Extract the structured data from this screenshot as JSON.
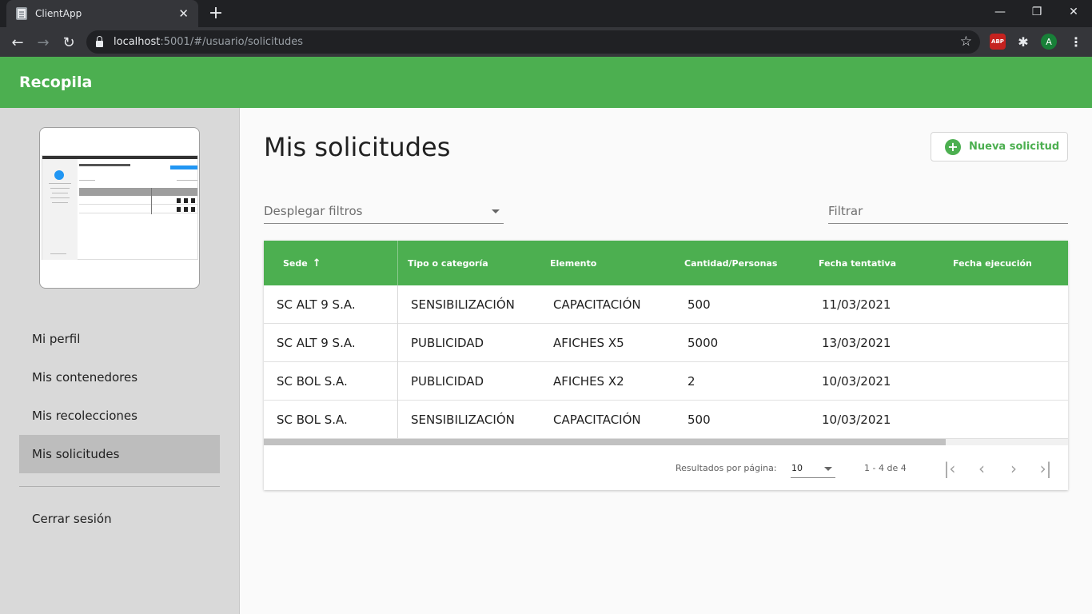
{
  "browser": {
    "tab_title": "ClientApp",
    "new_tab": "+",
    "url_host": "localhost",
    "url_rest": ":5001/#/usuario/solicitudes",
    "ext_abp": "ABP",
    "profile_initial": "A"
  },
  "app": {
    "brand": "Recopila"
  },
  "sidebar": {
    "items": [
      {
        "label": "Mi perfil"
      },
      {
        "label": "Mis contenedores"
      },
      {
        "label": "Mis recolecciones"
      },
      {
        "label": "Mis solicitudes",
        "active": true
      }
    ],
    "logout": "Cerrar sesión"
  },
  "main": {
    "title": "Mis solicitudes",
    "new_button": "Nueva solicitud",
    "filters_select": "Desplegar filtros",
    "filter_input_placeholder": "Filtrar"
  },
  "table": {
    "columns": [
      "Sede",
      "Tipo o categoría",
      "Elemento",
      "Cantidad/Personas",
      "Fecha tentativa",
      "Fecha ejecución"
    ],
    "sorted_column": "Sede",
    "sort_direction": "asc",
    "rows": [
      {
        "sede": "SC ALT 9 S.A.",
        "tipo": "SENSIBILIZACIÓN",
        "elemento": "CAPACITACIÓN",
        "cantidad": "500",
        "fecha_tentativa": "11/03/2021",
        "fecha_ejecucion": ""
      },
      {
        "sede": "SC ALT 9 S.A.",
        "tipo": "PUBLICIDAD",
        "elemento": "AFICHES X5",
        "cantidad": "5000",
        "fecha_tentativa": "13/03/2021",
        "fecha_ejecucion": ""
      },
      {
        "sede": "SC BOL S.A.",
        "tipo": "PUBLICIDAD",
        "elemento": "AFICHES X2",
        "cantidad": "2",
        "fecha_tentativa": "10/03/2021",
        "fecha_ejecucion": ""
      },
      {
        "sede": "SC BOL S.A.",
        "tipo": "SENSIBILIZACIÓN",
        "elemento": "CAPACITACIÓN",
        "cantidad": "500",
        "fecha_tentativa": "10/03/2021",
        "fecha_ejecucion": ""
      }
    ]
  },
  "paginator": {
    "label": "Resultados por página:",
    "page_size": "10",
    "range": "1 - 4 de 4"
  },
  "colors": {
    "brand_green": "#4caf50",
    "sidebar_bg": "#d9d9d9",
    "active_item_bg": "#bdbdbd"
  },
  "icons": [
    "lock-icon",
    "star-icon",
    "puzzle-icon",
    "plus-circle-icon",
    "arrow-upward-icon",
    "first-page-icon",
    "chevron-left-icon",
    "chevron-right-icon",
    "last-page-icon"
  ]
}
